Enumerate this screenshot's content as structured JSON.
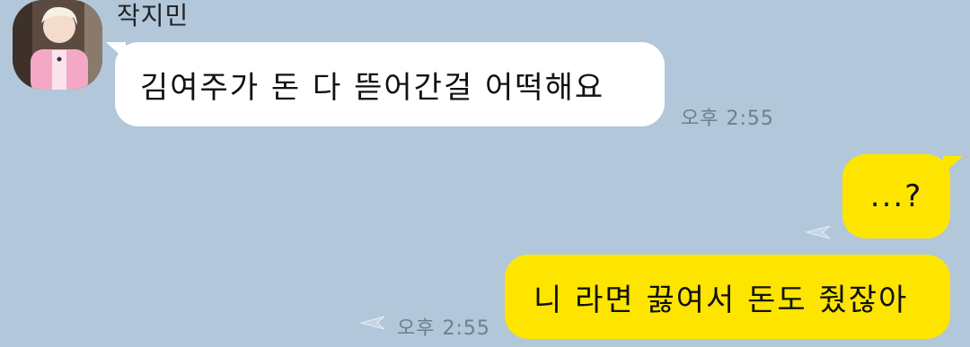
{
  "chat": {
    "sender_name": "작지민",
    "messages": [
      {
        "direction": "incoming",
        "text": "김여주가 돈 다 뜯어간걸 어떡해요",
        "time": "오후 2:55"
      },
      {
        "direction": "outgoing",
        "text": "...?"
      },
      {
        "direction": "outgoing",
        "text": "니 라면 끓여서 돈도 줬잖아",
        "time": "오후 2:55"
      }
    ]
  },
  "colors": {
    "background": "#b2c7da",
    "incoming_bubble": "#ffffff",
    "outgoing_bubble": "#fee500",
    "timestamp": "#6e7f8e"
  },
  "icons": [
    "avatar",
    "read-arrow-icon"
  ]
}
